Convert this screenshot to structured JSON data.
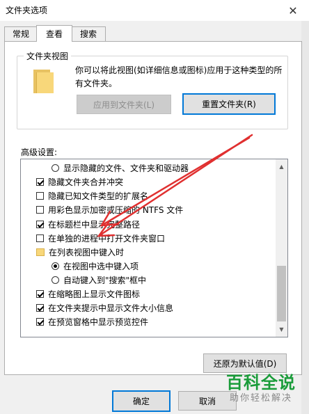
{
  "window": {
    "title": "文件夹选项",
    "close_glyph": "✕"
  },
  "tabs": [
    {
      "label": "常规",
      "active": false
    },
    {
      "label": "查看",
      "active": true
    },
    {
      "label": "搜索",
      "active": false
    }
  ],
  "folder_views": {
    "legend": "文件夹视图",
    "description": "你可以将此视图(如详细信息或图标)应用于这种类型的所有文件夹。",
    "apply_button": "应用到文件夹(L)",
    "reset_button": "重置文件夹(R)"
  },
  "advanced": {
    "label": "高级设置:",
    "items": [
      {
        "type": "radio",
        "checked": false,
        "indent": 1,
        "label": "显示隐藏的文件、文件夹和驱动器"
      },
      {
        "type": "checkbox",
        "checked": true,
        "indent": 0,
        "label": "隐藏文件夹合并冲突"
      },
      {
        "type": "checkbox",
        "checked": false,
        "indent": 0,
        "label": "隐藏已知文件类型的扩展名"
      },
      {
        "type": "checkbox",
        "checked": false,
        "indent": 0,
        "label": "用彩色显示加密或压缩的 NTFS 文件"
      },
      {
        "type": "checkbox",
        "checked": true,
        "indent": 0,
        "label": "在标题栏中显示完整路径"
      },
      {
        "type": "checkbox",
        "checked": false,
        "indent": 0,
        "label": "在单独的进程中打开文件夹窗口"
      },
      {
        "type": "folder",
        "checked": false,
        "indent": 0,
        "label": "在列表视图中键入时"
      },
      {
        "type": "radio",
        "checked": true,
        "indent": 1,
        "label": "在视图中选中键入项"
      },
      {
        "type": "radio",
        "checked": false,
        "indent": 1,
        "label": "自动键入到\"搜索\"框中"
      },
      {
        "type": "checkbox",
        "checked": true,
        "indent": 0,
        "label": "在缩略图上显示文件图标"
      },
      {
        "type": "checkbox",
        "checked": true,
        "indent": 0,
        "label": "在文件夹提示中显示文件大小信息"
      },
      {
        "type": "checkbox",
        "checked": true,
        "indent": 0,
        "label": "在预览窗格中显示预览控件"
      }
    ],
    "restore_button": "还原为默认值(D)"
  },
  "footer": {
    "ok_button": "确定",
    "cancel_button": "取消"
  },
  "watermark": {
    "main": "百科全说",
    "sub": "助你轻松解决"
  },
  "icons": {
    "scroll_up": "scroll-up-icon",
    "scroll_down": "scroll-down-icon",
    "folder": "folder-icon"
  },
  "colors": {
    "accent": "#0078d7",
    "annotation_arrow": "#e03030",
    "watermark": "#1a9c3a"
  }
}
